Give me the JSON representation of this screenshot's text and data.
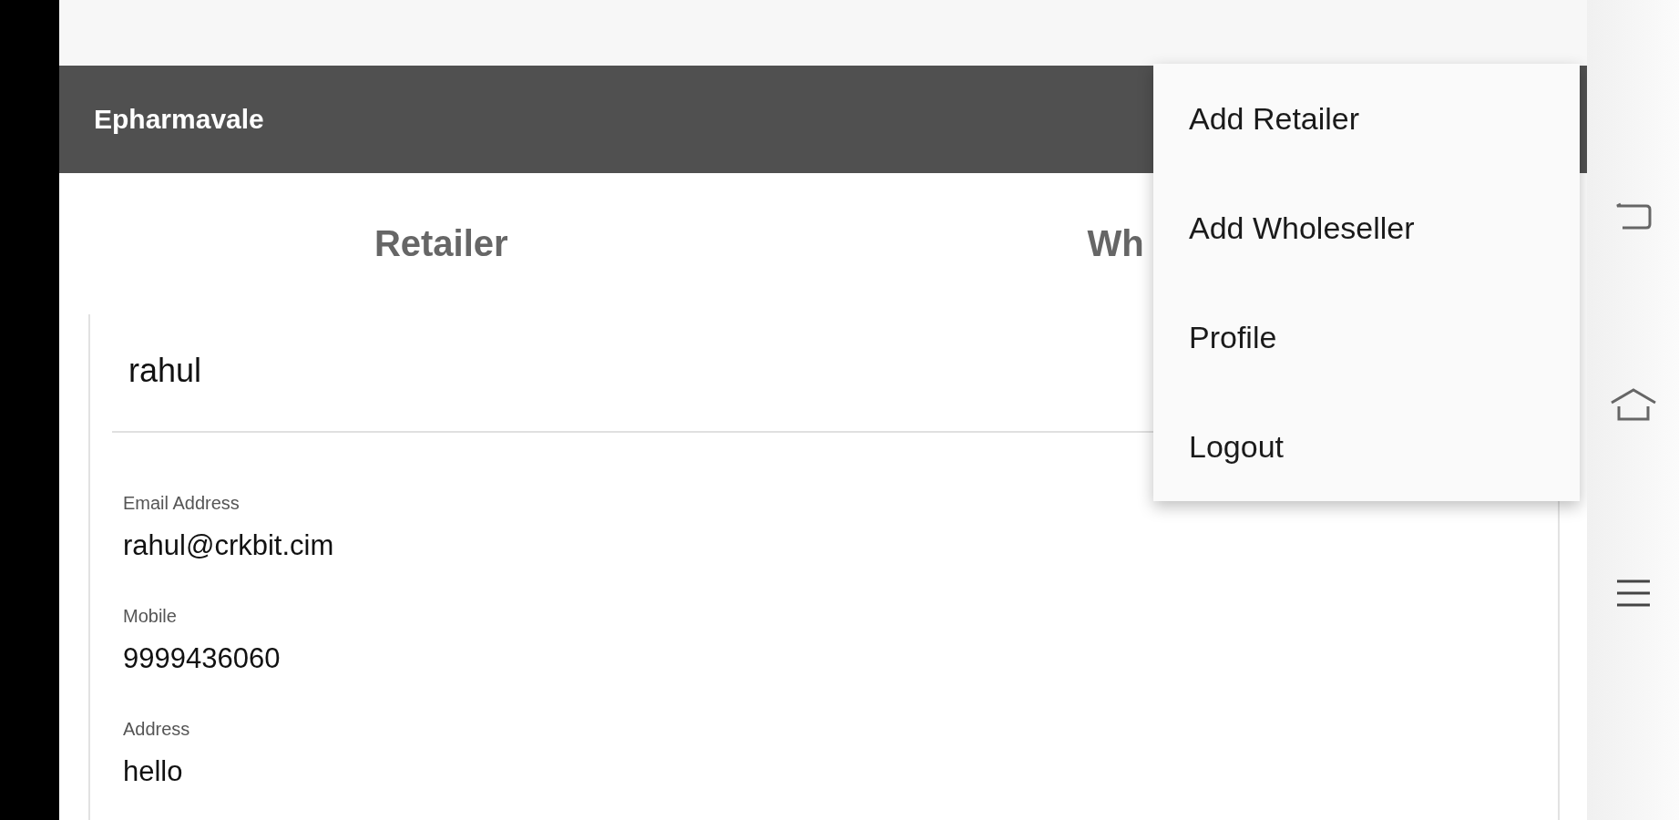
{
  "app_bar": {
    "title": "Epharmavale"
  },
  "tabs": [
    {
      "label": "Retailer"
    },
    {
      "label": "Wh"
    }
  ],
  "card": {
    "name": "rahul",
    "fields": [
      {
        "label": "Email Address",
        "value": "rahul@crkbit.cim"
      },
      {
        "label": "Mobile",
        "value": "9999436060"
      },
      {
        "label": "Address",
        "value": "hello"
      }
    ]
  },
  "menu": {
    "items": [
      "Add Retailer",
      "Add Wholeseller",
      "Profile",
      "Logout"
    ]
  }
}
